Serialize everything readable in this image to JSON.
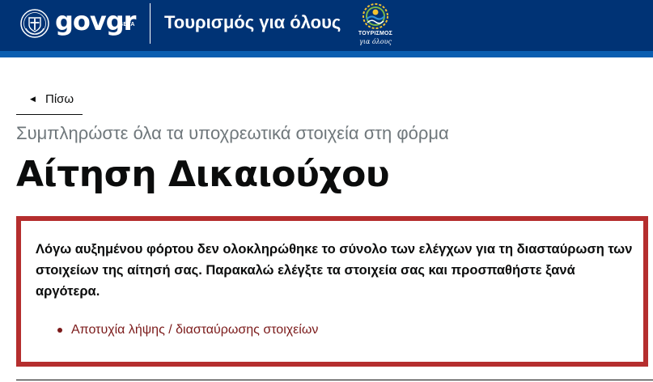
{
  "header": {
    "brand": "govgr",
    "beta_label": "BETA",
    "service_title": "Τουρισμός για όλους",
    "logo_word": "ΤΟΥΡΙΣΜΟΣ",
    "logo_sub": "για όλους",
    "icons": [
      "greek-emblem-icon",
      "tourism-logo-icon"
    ],
    "colors": {
      "header_bg": "#003375",
      "header_stripe": "#0a5eb0"
    }
  },
  "nav": {
    "back_label": "Πίσω",
    "back_icon": "caret-left-icon"
  },
  "main": {
    "caption": "Συμπληρώστε όλα τα υποχρεωτικά στοιχεία στη φόρμα",
    "title": "Αίτηση Δικαιούχου"
  },
  "error_summary": {
    "message": "Λόγω αυξημένου φόρτου δεν ολοκληρώθηκε το σύνολο των ελέγχων για τη διασταύρωση των στοιχείων της αίτησή σας. Παρακαλώ ελέγξτε τα στοιχεία σας και προσπαθήστε ξανά αργότερα.",
    "items": [
      "Αποτυχία λήψης / διασταύρωσης στοιχείων"
    ],
    "colors": {
      "border": "#b52e2e",
      "link": "#7b1a1a"
    }
  }
}
